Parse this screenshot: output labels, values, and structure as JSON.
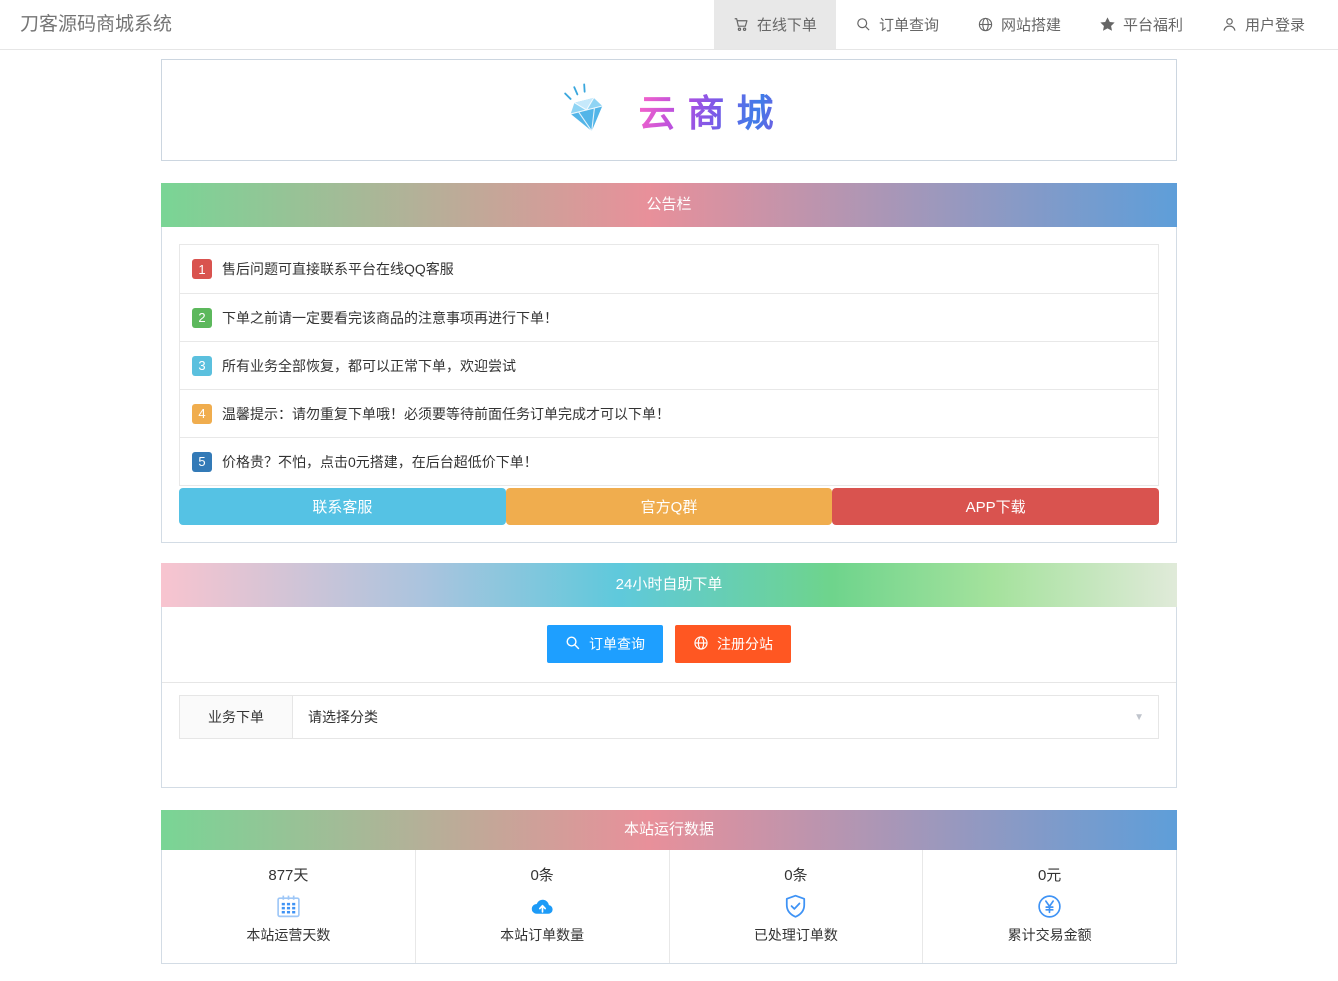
{
  "navbar": {
    "title": "刀客源码商城系统",
    "items": [
      {
        "label": "在线下单",
        "icon": "cart",
        "active": true
      },
      {
        "label": "订单查询",
        "icon": "search",
        "active": false
      },
      {
        "label": "网站搭建",
        "icon": "globe",
        "active": false
      },
      {
        "label": "平台福利",
        "icon": "star",
        "active": false
      },
      {
        "label": "用户登录",
        "icon": "user",
        "active": false
      }
    ]
  },
  "logo": {
    "brand": "云商城"
  },
  "announcement": {
    "title": "公告栏",
    "items": [
      {
        "num": "1",
        "text": "售后问题可直接联系平台在线QQ客服",
        "color": "#d9534f"
      },
      {
        "num": "2",
        "text": "下单之前请一定要看完该商品的注意事项再进行下单！",
        "color": "#5cb85c"
      },
      {
        "num": "3",
        "text": "所有业务全部恢复，都可以正常下单，欢迎尝试",
        "color": "#5bc0de"
      },
      {
        "num": "4",
        "text": "温馨提示：请勿重复下单哦！必须要等待前面任务订单完成才可以下单！",
        "color": "#f0ad4e"
      },
      {
        "num": "5",
        "text": "价格贵？不怕，点击0元搭建，在后台超低价下单！",
        "color": "#337ab7"
      }
    ],
    "buttons": [
      {
        "label": "联系客服",
        "color": "#55c2e4"
      },
      {
        "label": "官方Q群",
        "color": "#f0ad4e"
      },
      {
        "label": "APP下载",
        "color": "#d9534f"
      }
    ]
  },
  "selfService": {
    "title": "24小时自助下单",
    "buttons": [
      {
        "label": "订单查询",
        "icon": "search",
        "color": "#1e9fff"
      },
      {
        "label": "注册分站",
        "icon": "globe",
        "color": "#ff5722"
      }
    ],
    "orderForm": {
      "label": "业务下单",
      "placeholder": "请选择分类"
    }
  },
  "stats": {
    "title": "本站运行数据",
    "accent": "#3f93f5",
    "items": [
      {
        "value": "877天",
        "label": "本站运营天数",
        "icon": "calendar"
      },
      {
        "value": "0条",
        "label": "本站订单数量",
        "icon": "cloud-upload"
      },
      {
        "value": "0条",
        "label": "已处理订单数",
        "icon": "shield-check"
      },
      {
        "value": "0元",
        "label": "累计交易金额",
        "icon": "yuan"
      }
    ]
  }
}
